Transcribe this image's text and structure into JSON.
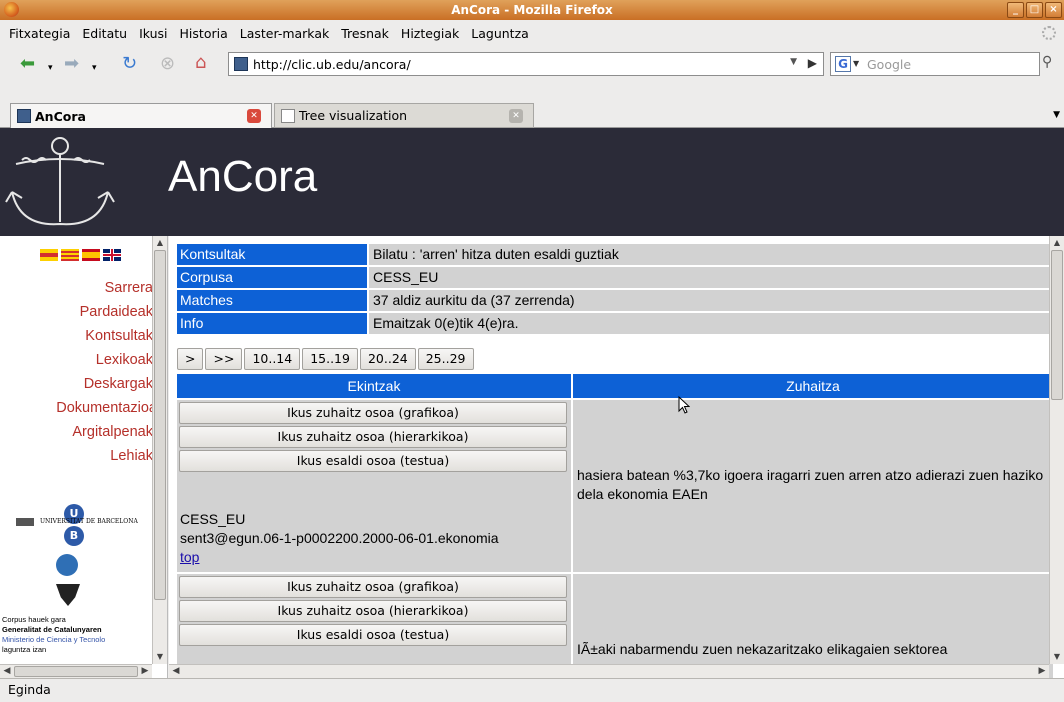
{
  "window": {
    "title": "AnCora - Mozilla Firefox",
    "buttons": [
      "_",
      "□",
      "×"
    ]
  },
  "menu": [
    "Fitxategia",
    "Editatu",
    "Ikusi",
    "Historia",
    "Laster-markak",
    "Tresnak",
    "Hiztegiak",
    "Laguntza"
  ],
  "nav": {
    "url": "http://clic.ub.edu/ancora/",
    "search_placeholder": "Google",
    "icons": [
      "back-icon",
      "forward-icon",
      "reload-icon",
      "stop-icon",
      "home-icon"
    ]
  },
  "tabs": [
    {
      "label": "AnCora",
      "active": true
    },
    {
      "label": "Tree visualization",
      "active": false
    }
  ],
  "banner": {
    "title": "AnCora"
  },
  "sidebar": {
    "flags": [
      "Basque",
      "Catalan",
      "Spanish",
      "English"
    ],
    "links": [
      "Sarrera",
      "Pardaideak",
      "Kontsultak",
      "Lexikoak",
      "Deskargak",
      "Dokumentazioa",
      "Argitalpenak",
      "Lehiak"
    ],
    "ub_text": "UNIVERSITAT DE BARCELONA",
    "credits": [
      "Corpus         hauek          gara",
      "Generalitat  de  Catalunyaren",
      "Ministerio de Ciencia y Tecnolo",
      "laguntza           izan"
    ]
  },
  "info": [
    {
      "key": "Kontsultak",
      "value": "Bilatu : 'arren' hitza duten esaldi guztiak"
    },
    {
      "key": "Corpusa",
      "value": "CESS_EU"
    },
    {
      "key": "Matches",
      "value": "37 aldiz aurkitu da (37 zerrenda)"
    },
    {
      "key": "Info",
      "value": "Emaitzak 0(e)tik 4(e)ra."
    }
  ],
  "pager": [
    ">",
    ">>",
    "10..14",
    "15..19",
    "20..24",
    "25..29"
  ],
  "table": {
    "headers": [
      "Ekintzak",
      "Zuhaitza"
    ],
    "actions": [
      "Ikus zuhaitz osoa (grafikoa)",
      "Ikus zuhaitz osoa (hierarkikoa)",
      "Ikus esaldi osoa (testua)"
    ],
    "rows": [
      {
        "corpus": "CESS_EU",
        "sent": "sent3@egun.06-1-p0002200.2000-06-01.ekonomia",
        "top": "top",
        "text": "hasiera batean %3,7ko igoera iragarri zuen arren atzo adierazi zuen haziko dela ekonomia EAEn"
      },
      {
        "text": "IÃ±aki nabarmendu zuen nekazaritzako elikagaien sektorea"
      }
    ]
  },
  "status": "Eginda"
}
